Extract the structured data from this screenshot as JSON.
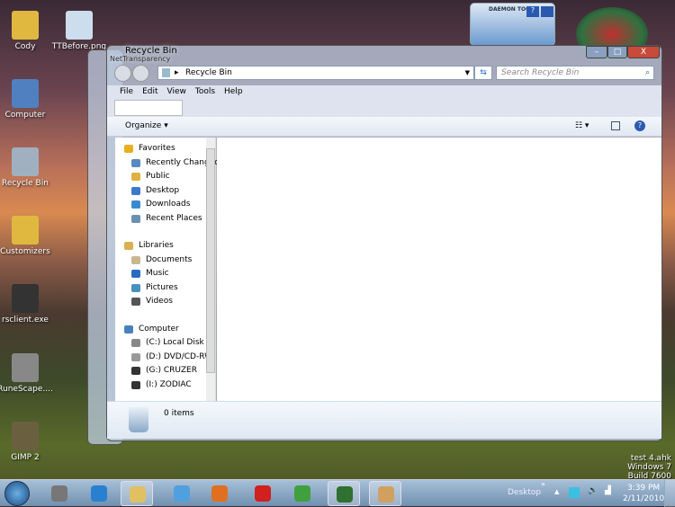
{
  "desktop": {
    "icons": [
      {
        "label": "Cody"
      },
      {
        "label": "Computer"
      },
      {
        "label": "Recycle Bin"
      },
      {
        "label": "Customizers"
      },
      {
        "label": "rsclient.exe"
      },
      {
        "label": "RuneScape...."
      },
      {
        "label": "GIMP 2"
      },
      {
        "label": "TTBefore.png"
      }
    ],
    "watermark": {
      "script": "test 4.ahk",
      "os": "Windows 7",
      "build": "Build 7600"
    }
  },
  "gadget": {
    "label": "DAEMON TOOLS"
  },
  "back_window": {
    "title": "NetTransparency",
    "menu_first": "File"
  },
  "window": {
    "title": "Recycle Bin",
    "address": "Recycle Bin",
    "search_placeholder": "Search Recycle Bin",
    "menu": [
      "File",
      "Edit",
      "View",
      "Tools",
      "Help"
    ],
    "organize": "Organize",
    "nav": [
      {
        "label": "Favorites",
        "header": true,
        "color": "#e8b020"
      },
      {
        "label": "Recently Changed",
        "color": "#5a8ac0"
      },
      {
        "label": "Public",
        "color": "#e0b040"
      },
      {
        "label": "Desktop",
        "color": "#3a7ac8"
      },
      {
        "label": "Downloads",
        "color": "#3a8ad0"
      },
      {
        "label": "Recent Places",
        "color": "#6a90b0"
      },
      {
        "label": "",
        "spacer": true
      },
      {
        "label": "Libraries",
        "header": true,
        "color": "#d8b050"
      },
      {
        "label": "Documents",
        "color": "#c8b890"
      },
      {
        "label": "Music",
        "color": "#2a6ac0"
      },
      {
        "label": "Pictures",
        "color": "#4a90c0"
      },
      {
        "label": "Videos",
        "color": "#555"
      },
      {
        "label": "",
        "spacer": true
      },
      {
        "label": "Computer",
        "header": true,
        "color": "#4a80c0"
      },
      {
        "label": "(C:) Local Disk",
        "color": "#888"
      },
      {
        "label": "(D:) DVD/CD-RW",
        "color": "#999"
      },
      {
        "label": "(G:) CRUZER",
        "color": "#333"
      },
      {
        "label": "(I:) ZODIAC",
        "color": "#333"
      }
    ],
    "status": "0 items"
  },
  "taskbar": {
    "desktop_label": "Desktop",
    "chevron": "»",
    "time": "3:39 PM",
    "date": "2/11/2010"
  }
}
